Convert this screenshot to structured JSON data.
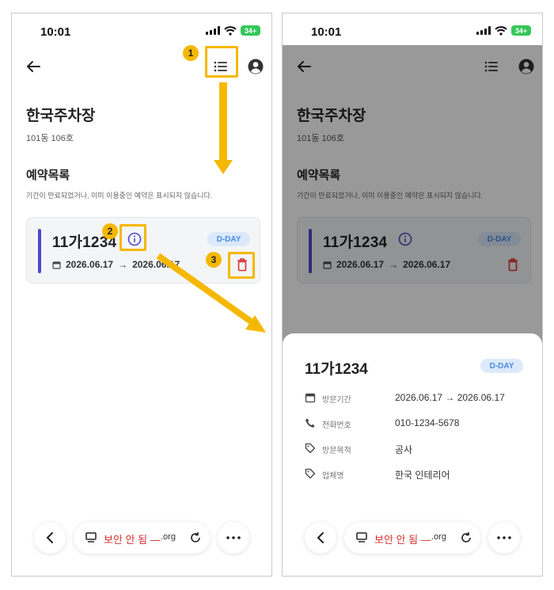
{
  "status": {
    "time": "10:01",
    "battery": "34+"
  },
  "page": {
    "title": "한국주차장",
    "unit": "101동 106호",
    "section_title": "예약목록",
    "section_note": "기간이 만료되었거나, 이미 이용중인 예약은 표시되지 않습니다."
  },
  "reservation": {
    "plate": "11가1234",
    "badge": "D-DAY",
    "start": "2026.06.17",
    "arrow": "→",
    "end": "2026.06.17"
  },
  "browser": {
    "security_warning": "보안 안 됨 —",
    "domain": ".org"
  },
  "sheet": {
    "title": "11가1234",
    "badge": "D-DAY",
    "rows": [
      {
        "icon": "calendar-icon",
        "label": "방문기간",
        "value": "2026.06.17 → 2026.06.17"
      },
      {
        "icon": "phone-icon",
        "label": "전화번호",
        "value": "010-1234-5678"
      },
      {
        "icon": "tag-icon",
        "label": "방문목적",
        "value": "공사"
      },
      {
        "icon": "tag-icon",
        "label": "업체명",
        "value": "한국 인테리어"
      }
    ]
  },
  "callouts": [
    "1",
    "2",
    "3"
  ],
  "colors": {
    "accent_bar": "#4f46c9",
    "highlight": "#f5b800",
    "danger": "#d93030",
    "badge_bg": "#dbe9fb",
    "badge_text": "#4a8be0"
  }
}
